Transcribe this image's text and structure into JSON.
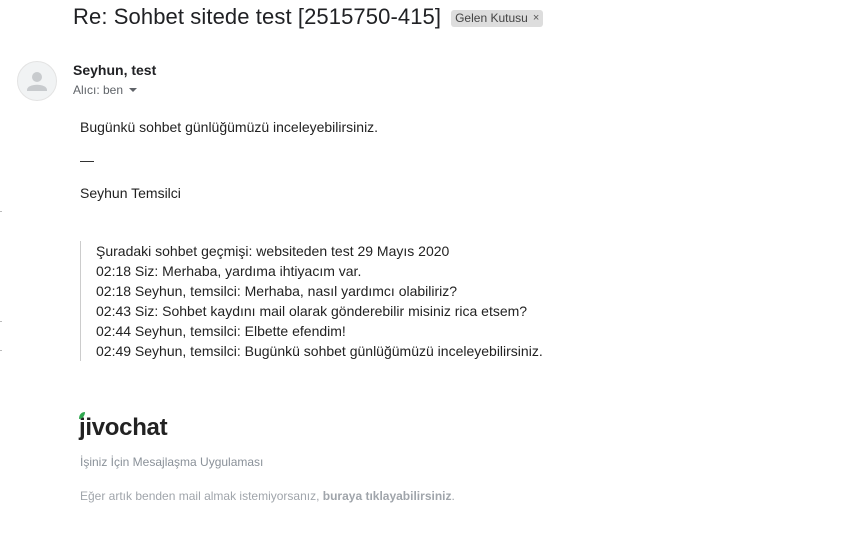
{
  "email": {
    "subject": "Re: Sohbet sitede test [2515750-415]",
    "label": "Gelen Kutusu",
    "label_remove": "×",
    "sender": "Seyhun, test",
    "recipient": "Alıcı: ben",
    "body_line": "Bugünkü sohbet günlüğümüzü inceleyebilirsiniz.",
    "separator": "—",
    "signature": "Seyhun Temsilci",
    "quoted_history": [
      "Şuradaki sohbet geçmişi: websiteden test 29 Mayıs 2020",
      "02:18 Siz: Merhaba, yardıma ihtiyacım var.",
      "02:18 Seyhun, temsilci: Merhaba, nasıl yardımcı olabiliriz?",
      "02:43 Siz: Sohbet kaydını mail olarak gönderebilir misiniz rica etsem?",
      "02:44 Seyhun, temsilci: Elbette efendim!",
      "02:49 Seyhun, temsilci: Bugünkü sohbet günlüğümüzü inceleyebilirsiniz."
    ]
  },
  "footer": {
    "logo_text": "jivochat",
    "logo_color": "#2fa84f",
    "tagline": "İşiniz İçin Mesajlaşma Uygulaması",
    "unsubscribe_text": "Eğer artık benden mail almak istemiyorsanız, ",
    "unsubscribe_link": "buraya tıklayabilirsiniz",
    "unsubscribe_end": "."
  }
}
